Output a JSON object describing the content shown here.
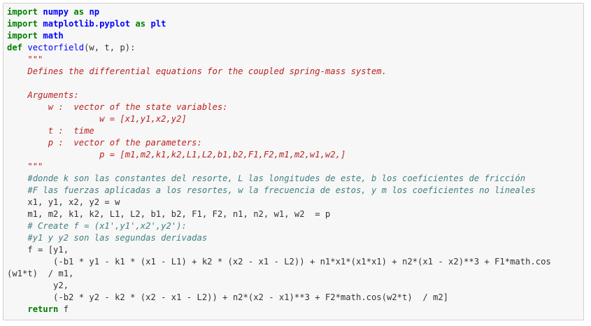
{
  "colors": {
    "background": "#f7f7f7",
    "border": "#cfcfcf",
    "keyword": "#008000",
    "module": "#0000ff",
    "function": "#0000ff",
    "docstring": "#ba2121",
    "comment": "#408080",
    "text": "#333333"
  },
  "code": {
    "lines": [
      [
        {
          "c": "kw",
          "t": "import"
        },
        {
          "c": "plain",
          "t": " "
        },
        {
          "c": "mod",
          "t": "numpy"
        },
        {
          "c": "plain",
          "t": " "
        },
        {
          "c": "kw",
          "t": "as"
        },
        {
          "c": "plain",
          "t": " "
        },
        {
          "c": "mod",
          "t": "np"
        }
      ],
      [
        {
          "c": "kw",
          "t": "import"
        },
        {
          "c": "plain",
          "t": " "
        },
        {
          "c": "mod",
          "t": "matplotlib.pyplot"
        },
        {
          "c": "plain",
          "t": " "
        },
        {
          "c": "kw",
          "t": "as"
        },
        {
          "c": "plain",
          "t": " "
        },
        {
          "c": "mod",
          "t": "plt"
        }
      ],
      [
        {
          "c": "kw",
          "t": "import"
        },
        {
          "c": "plain",
          "t": " "
        },
        {
          "c": "mod",
          "t": "math"
        }
      ],
      [
        {
          "c": "kw",
          "t": "def"
        },
        {
          "c": "plain",
          "t": " "
        },
        {
          "c": "fn",
          "t": "vectorfield"
        },
        {
          "c": "plain",
          "t": "(w, t, p):"
        }
      ],
      [
        {
          "c": "plain",
          "t": "    "
        },
        {
          "c": "str",
          "t": "\"\"\""
        }
      ],
      [
        {
          "c": "plain",
          "t": "    "
        },
        {
          "c": "str",
          "t": "Defines the differential equations for the coupled spring-mass system."
        }
      ],
      [
        {
          "c": "plain",
          "t": ""
        }
      ],
      [
        {
          "c": "plain",
          "t": "    "
        },
        {
          "c": "str",
          "t": "Arguments:"
        }
      ],
      [
        {
          "c": "plain",
          "t": "        "
        },
        {
          "c": "str",
          "t": "w :  vector of the state variables:"
        }
      ],
      [
        {
          "c": "plain",
          "t": "                  "
        },
        {
          "c": "str",
          "t": "w = [x1,y1,x2,y2]"
        }
      ],
      [
        {
          "c": "plain",
          "t": "        "
        },
        {
          "c": "str",
          "t": "t :  time"
        }
      ],
      [
        {
          "c": "plain",
          "t": "        "
        },
        {
          "c": "str",
          "t": "p :  vector of the parameters:"
        }
      ],
      [
        {
          "c": "plain",
          "t": "                  "
        },
        {
          "c": "str",
          "t": "p = [m1,m2,k1,k2,L1,L2,b1,b2,F1,F2,m1,m2,w1,w2,]"
        }
      ],
      [
        {
          "c": "plain",
          "t": "    "
        },
        {
          "c": "str",
          "t": "\"\"\""
        }
      ],
      [
        {
          "c": "plain",
          "t": "    "
        },
        {
          "c": "cmt",
          "t": "#donde k son las constantes del resorte, L las longitudes de este, b los coeficientes de fricción"
        }
      ],
      [
        {
          "c": "plain",
          "t": "    "
        },
        {
          "c": "cmt",
          "t": "#F las fuerzas aplicadas a los resortes, w la frecuencia de estos, y m los coeficientes no lineales"
        }
      ],
      [
        {
          "c": "plain",
          "t": "    x1, y1, x2, y2 = w"
        }
      ],
      [
        {
          "c": "plain",
          "t": "    m1, m2, k1, k2, L1, L2, b1, b2, F1, F2, n1, n2, w1, w2  = p"
        }
      ],
      [
        {
          "c": "plain",
          "t": "    "
        },
        {
          "c": "cmt",
          "t": "# Create f = (x1',y1',x2',y2'):"
        }
      ],
      [
        {
          "c": "plain",
          "t": "    "
        },
        {
          "c": "cmt",
          "t": "#y1 y y2 son las segundas derivadas"
        }
      ],
      [
        {
          "c": "plain",
          "t": "    f = [y1,"
        }
      ],
      [
        {
          "c": "plain",
          "t": "         (-b1 * y1 - k1 * (x1 - L1) + k2 * (x2 - x1 - L2)) + n1*x1*(x1*x1) + n2*(x1 - x2)**3 + F1*math.cos"
        }
      ],
      [
        {
          "c": "plain",
          "t": "(w1*t)  / m1,"
        }
      ],
      [
        {
          "c": "plain",
          "t": "         y2,"
        }
      ],
      [
        {
          "c": "plain",
          "t": "         (-b2 * y2 - k2 * (x2 - x1 - L2)) + n2*(x2 - x1)**3 + F2*math.cos(w2*t)  / m2]"
        }
      ],
      [
        {
          "c": "plain",
          "t": "    "
        },
        {
          "c": "kw",
          "t": "return"
        },
        {
          "c": "plain",
          "t": " f"
        }
      ]
    ]
  }
}
